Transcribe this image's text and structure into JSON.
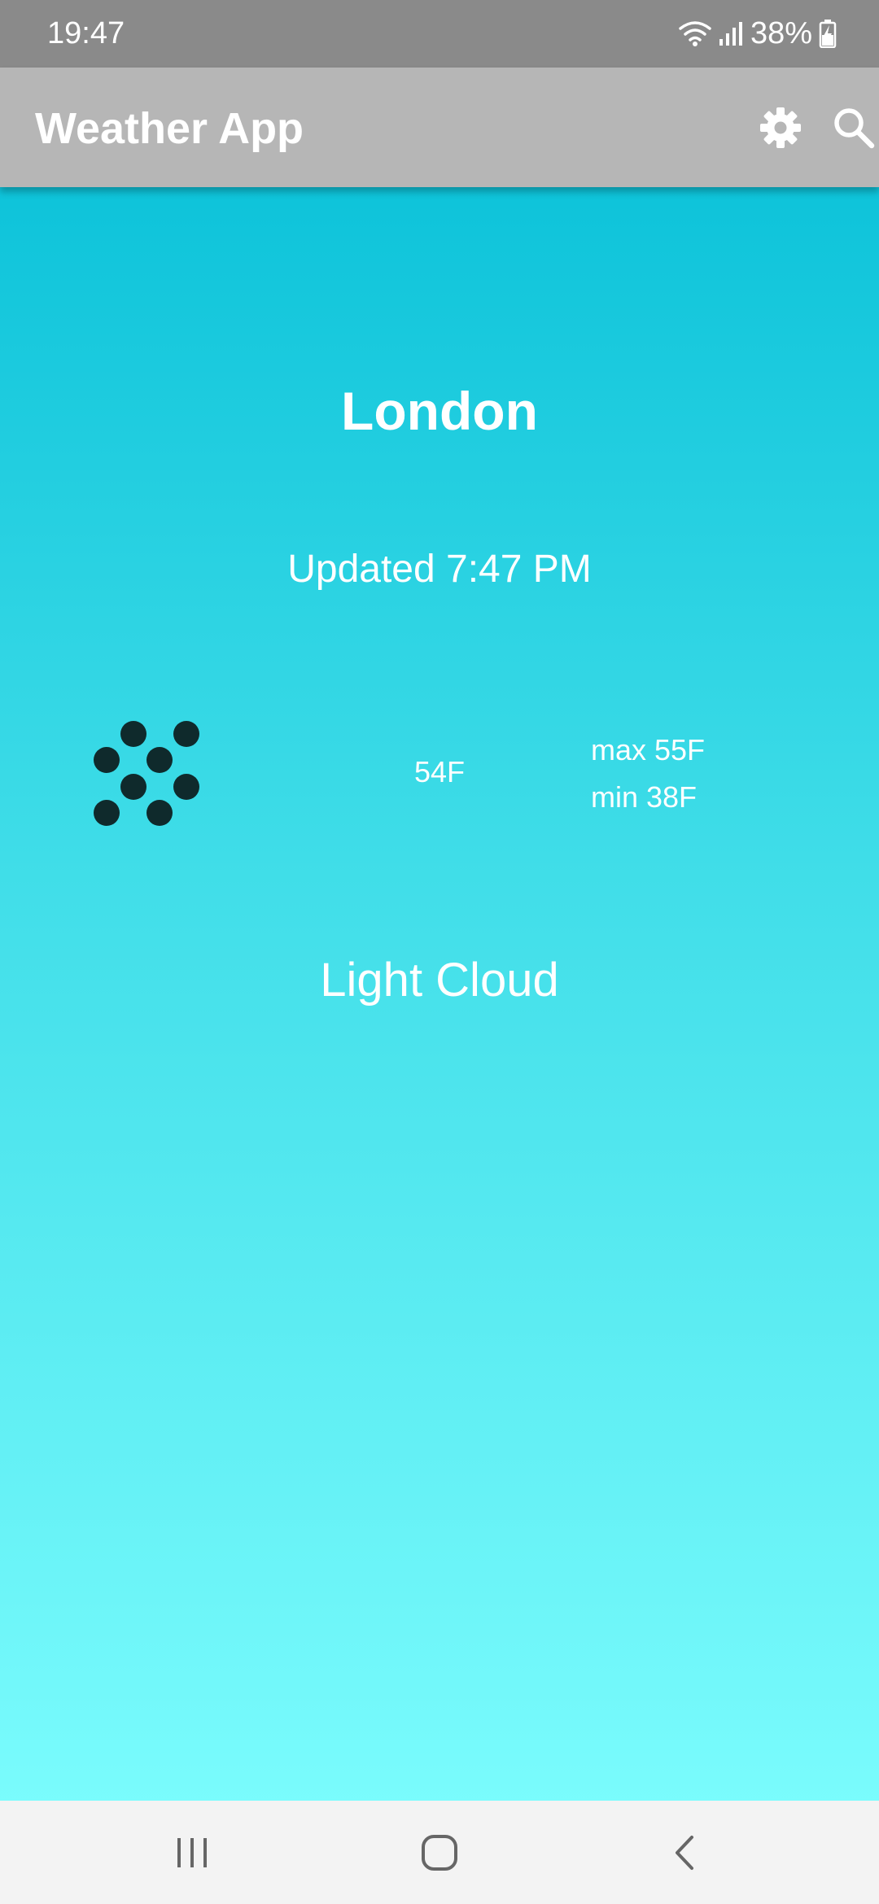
{
  "status_bar": {
    "time": "19:47",
    "battery_percent": "38%",
    "icons": [
      "wifi-icon",
      "signal-icon",
      "battery-charging-icon"
    ]
  },
  "app_bar": {
    "title": "Weather App",
    "actions": [
      "gear-icon",
      "search-icon"
    ]
  },
  "weather": {
    "city": "London",
    "updated": "Updated 7:47 PM",
    "icon": "light-cloud-dots-icon",
    "current_temp": "54F",
    "max_temp": "max 55F",
    "min_temp": "min 38F",
    "condition": "Light Cloud"
  },
  "nav_bar": {
    "buttons": [
      "recents-icon",
      "home-icon",
      "back-icon"
    ]
  },
  "colors": {
    "gradient_top": "#00bcd6",
    "gradient_bottom": "#80ffff",
    "app_bar": "#b6b6b6",
    "status_bar": "#8a8a8a",
    "icon_dots": "#0f2a2c"
  }
}
